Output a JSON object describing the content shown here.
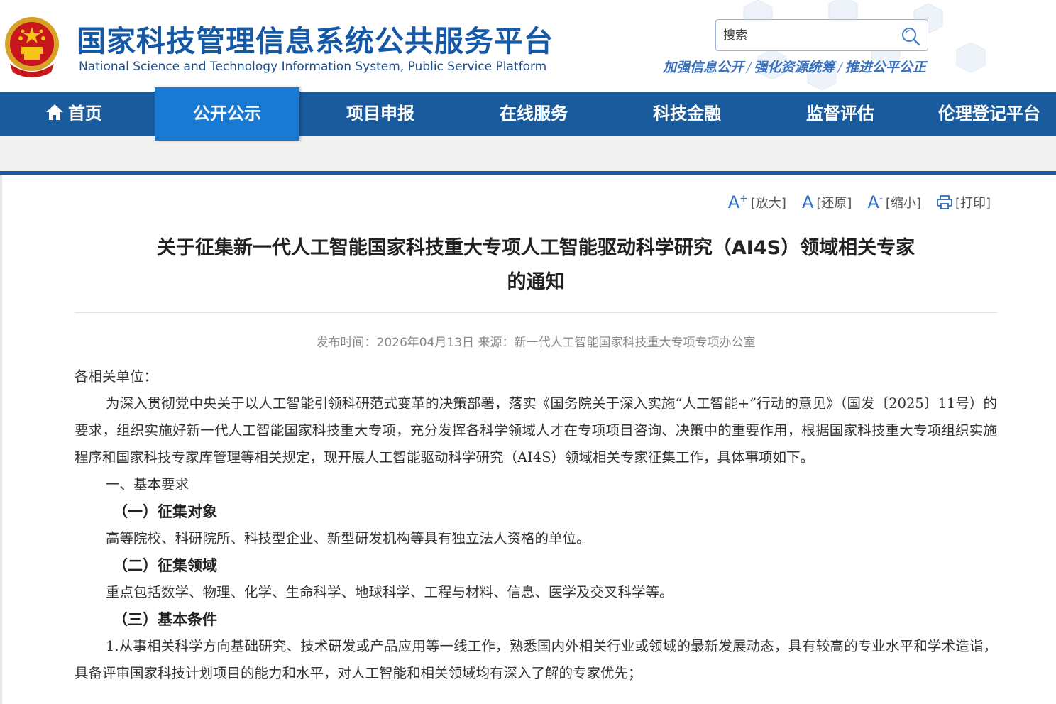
{
  "header": {
    "title_cn": "国家科技管理信息系统公共服务平台",
    "title_en": "National Science and Technology Information System, Public Service Platform",
    "search_placeholder": "搜索",
    "slogan": [
      "加强信息公开",
      "强化资源统筹",
      "推进公平公正"
    ],
    "slogan_sep": "/"
  },
  "nav": {
    "items": [
      "首页",
      "公开公示",
      "项目申报",
      "在线服务",
      "科技金融",
      "监督评估",
      "伦理登记平台"
    ],
    "active": "公开公示"
  },
  "tools": {
    "enlarge_glyph": "A",
    "enlarge_sup": "+",
    "enlarge": "[放大]",
    "reset_glyph": "A",
    "reset": "[还原]",
    "shrink_glyph": "A",
    "shrink_sup": "-",
    "shrink": "[缩小]",
    "print": "[打印]"
  },
  "article": {
    "title_line1": "关于征集新一代人工智能国家科技重大专项人工智能驱动科学研究（AI4S）领域相关专家",
    "title_line2": "的通知",
    "meta": "发布时间：2026年04月13日 来源：新一代人工智能国家科技重大专项专项办公室",
    "salutation": "各相关单位：",
    "para1": "为深入贯彻党中央关于以人工智能引领科研范式变革的决策部署，落实《国务院关于深入实施“人工智能+”行动的意见》（国发〔2025〕11号）的要求，组织实施好新一代人工智能国家科技重大专项，充分发挥各科学领域人才在专项项目咨询、决策中的重要作用，根据国家科技重大专项组织实施程序和国家科技专家库管理等相关规定，现开展人工智能驱动科学研究（AI4S）领域相关专家征集工作，具体事项如下。",
    "section1": "一、基本要求",
    "sub1": "（一）征集对象",
    "sub1_text": "高等院校、科研院所、科技型企业、新型研发机构等具有独立法人资格的单位。",
    "sub2": "（二）征集领域",
    "sub2_text": "重点包括数学、物理、化学、生命科学、地球科学、工程与材料、信息、医学及交叉科学等。",
    "sub3": "（三）基本条件",
    "cond1": "1.从事相关科学方向基础研究、技术研发或产品应用等一线工作，熟悉国内外相关行业或领域的最新发展动态，具有较高的专业水平和学术造诣，具备评审国家科技计划项目的能力和水平，对人工智能和相关领域均有深入了解的专家优先；"
  },
  "colors": {
    "brand_blue": "#195b9d",
    "nav_active": "#1a7ad3",
    "title_blue": "#1559a6"
  }
}
